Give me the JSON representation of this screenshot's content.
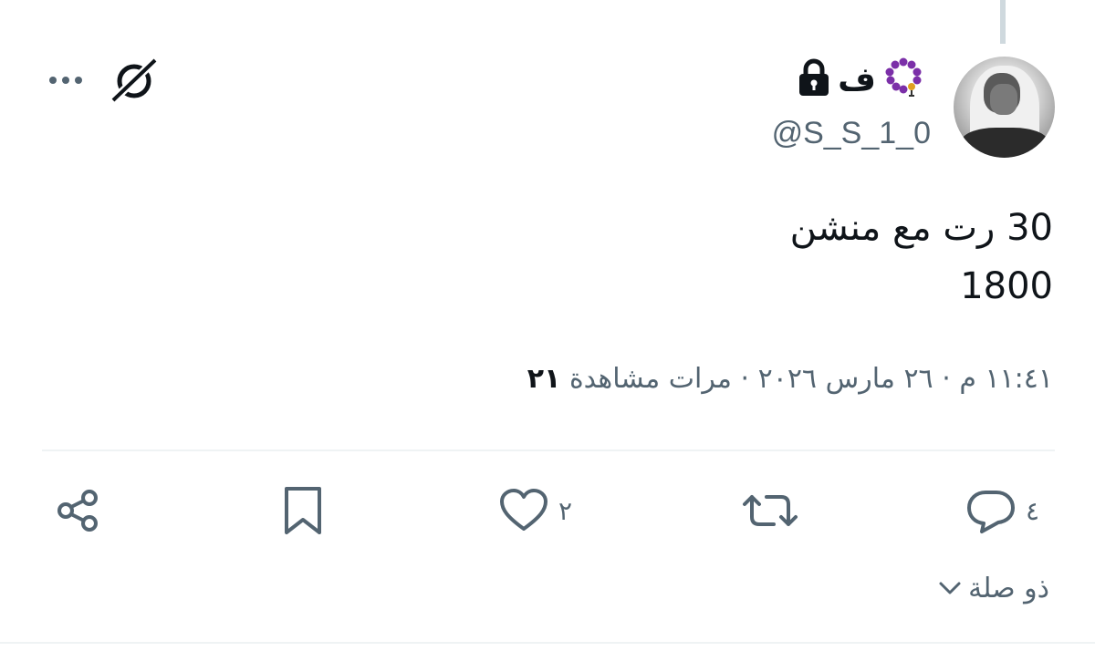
{
  "tweet": {
    "display_name": "ف",
    "handle": "@S_S_1_0",
    "text_lines": [
      "30 رت مع منشن",
      "1800"
    ],
    "time": "١١:٤١ م",
    "date": "٢٦ مارس ٢٠٢٦",
    "separator": "·",
    "views_label": "مرات مشاهدة",
    "views_count": "٢١"
  },
  "actions": {
    "reply_count": "٤",
    "retweet_count": "",
    "like_count": "٢"
  },
  "related": {
    "label": "ذو صلة"
  },
  "icons": {
    "badge_emoji": "prayer-beads-icon",
    "lock": "lock-icon",
    "grok": "grok-icon",
    "more": "more-icon"
  },
  "colors": {
    "text": "#0f1419",
    "secondary": "#536471",
    "divider": "#eff3f4",
    "beads": "#7b2fa8"
  }
}
